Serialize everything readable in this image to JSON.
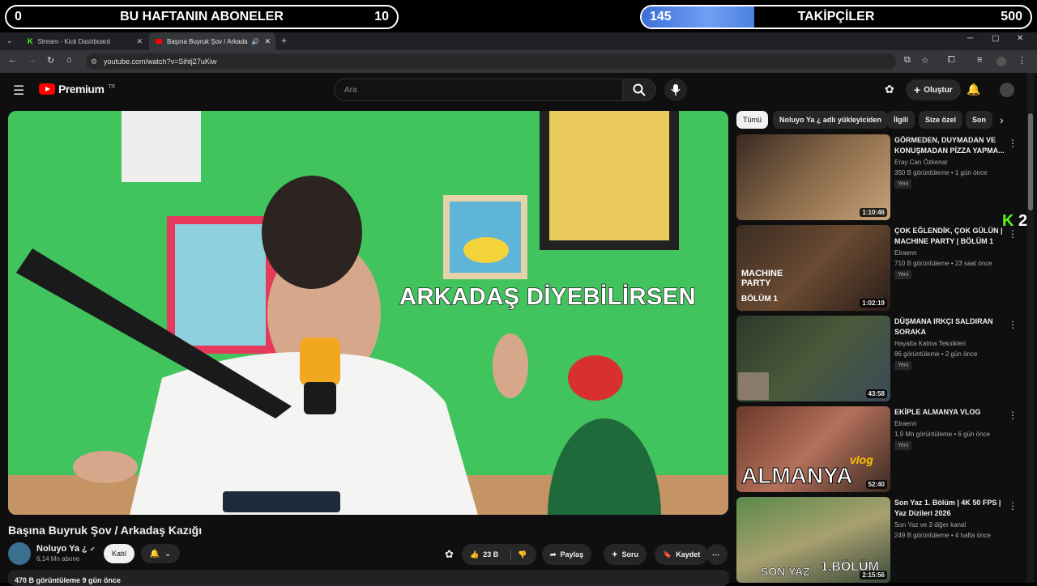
{
  "overlay": {
    "left": {
      "start": "0",
      "label": "BU HAFTANIN ABONELER",
      "end": "10"
    },
    "right": {
      "current": "145",
      "label": "TAKİPÇİLER",
      "goal": "500",
      "progress": 0.29
    }
  },
  "browser": {
    "tabs": [
      {
        "label": "Stream - Kick Dashboard"
      },
      {
        "label": "Başına Buyruk Şov / Arkada"
      }
    ],
    "url": "youtube.com/watch?v=Sihtj27uKiw"
  },
  "youtube": {
    "logo": "Premium",
    "logo_sup": "TR",
    "search_placeholder": "Ara",
    "create_label": "Oluştur",
    "video": {
      "caption": "ARKADAŞ DİYEBİLİRSEN",
      "title": "Başına Buyruk Şov / Arkadaş Kazığı",
      "channel": "Noluyo Ya ¿",
      "subscribers": "6,14 Mn abone",
      "join_label": "Katıl",
      "likes": "23 B",
      "share_label": "Paylaş",
      "ask_label": "Soru",
      "save_label": "Kaydet",
      "meta": "470 B görüntüleme  9 gün önce"
    },
    "chips": [
      "Tümü",
      "Noluyo Ya ¿ adlı yükleyiciden",
      "İlgili",
      "Size özel",
      "Son"
    ],
    "recommendations": [
      {
        "title": "GÖRMEDEN, DUYMADAN VE KONUŞMADAN PİZZA YAPMA...",
        "channel": "Eray Can Özkenar",
        "meta": "350 B görüntüleme • 1 gün önce",
        "badge": "Yeni",
        "duration": "1:10:46"
      },
      {
        "title": "ÇOK EĞLENDİK, ÇOK GÜLÜN | MACHINE PARTY | BÖLÜM 1",
        "channel": "Elraenn",
        "meta": "710 B görüntüleme • 23 saat önce",
        "badge": "Yeni",
        "duration": "1:02:19"
      },
      {
        "title": "DÜŞMANA IRKÇI SALDIRAN SORAKA",
        "channel": "Hayatta Kalma Teknikleri",
        "meta": "86 görüntüleme • 2 gün önce",
        "badge": "Yeni",
        "duration": "43:58"
      },
      {
        "title": "EKİPLE ALMANYA VLOG",
        "channel": "Elraenn",
        "meta": "1,9 Mn görüntüleme • 6 gün önce",
        "badge": "Yeni",
        "duration": "52:40"
      },
      {
        "title": "Son Yaz 1. Bölüm | 4K 50 FPS | Yaz Dizileri 2026",
        "channel": "Son Yaz  ve 3 diğer kanal",
        "meta": "249 B görüntüleme • 4 hafta önce",
        "badge": "",
        "duration": "2:15:56"
      }
    ],
    "thumb_text": {
      "machine": "MACHINE PARTY",
      "bolum": "BÖLÜM 1",
      "almanya": "ALMANYA",
      "vlog": "vlog",
      "sonyaz": "SON YAZ",
      "sonyaz_bolum": "1.BÖLÜM"
    },
    "kick_count": "2"
  }
}
